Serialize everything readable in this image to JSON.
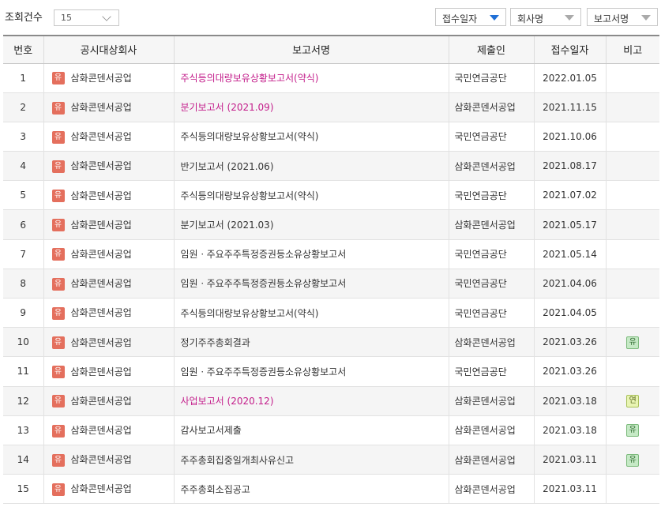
{
  "toolbar": {
    "count_label": "조회건수",
    "count_value": "15",
    "sort_receipt": "접수일자",
    "sort_company": "회사명",
    "sort_report": "보고서명"
  },
  "table": {
    "headers": [
      "번호",
      "공시대상회사",
      "보고서명",
      "제출인",
      "접수일자",
      "비고"
    ],
    "rows": [
      {
        "no": "1",
        "market": "유",
        "company": "삼화콘덴서공업",
        "report": "주식등의대량보유상황보고서(약식)",
        "report_highlight": true,
        "submitter": "국민연금공단",
        "date": "2022.01.05",
        "note": ""
      },
      {
        "no": "2",
        "market": "유",
        "company": "삼화콘덴서공업",
        "report": "분기보고서 (2021.09)",
        "report_highlight": true,
        "submitter": "삼화콘덴서공업",
        "date": "2021.11.15",
        "note": ""
      },
      {
        "no": "3",
        "market": "유",
        "company": "삼화콘덴서공업",
        "report": "주식등의대량보유상황보고서(약식)",
        "report_highlight": false,
        "submitter": "국민연금공단",
        "date": "2021.10.06",
        "note": ""
      },
      {
        "no": "4",
        "market": "유",
        "company": "삼화콘덴서공업",
        "report": "반기보고서 (2021.06)",
        "report_highlight": false,
        "submitter": "삼화콘덴서공업",
        "date": "2021.08.17",
        "note": ""
      },
      {
        "no": "5",
        "market": "유",
        "company": "삼화콘덴서공업",
        "report": "주식등의대량보유상황보고서(약식)",
        "report_highlight": false,
        "submitter": "국민연금공단",
        "date": "2021.07.02",
        "note": ""
      },
      {
        "no": "6",
        "market": "유",
        "company": "삼화콘덴서공업",
        "report": "분기보고서 (2021.03)",
        "report_highlight": false,
        "submitter": "삼화콘덴서공업",
        "date": "2021.05.17",
        "note": ""
      },
      {
        "no": "7",
        "market": "유",
        "company": "삼화콘덴서공업",
        "report": "임원ㆍ주요주주특정증권등소유상황보고서",
        "report_highlight": false,
        "submitter": "국민연금공단",
        "date": "2021.05.14",
        "note": ""
      },
      {
        "no": "8",
        "market": "유",
        "company": "삼화콘덴서공업",
        "report": "임원ㆍ주요주주특정증권등소유상황보고서",
        "report_highlight": false,
        "submitter": "국민연금공단",
        "date": "2021.04.06",
        "note": ""
      },
      {
        "no": "9",
        "market": "유",
        "company": "삼화콘덴서공업",
        "report": "주식등의대량보유상황보고서(약식)",
        "report_highlight": false,
        "submitter": "국민연금공단",
        "date": "2021.04.05",
        "note": ""
      },
      {
        "no": "10",
        "market": "유",
        "company": "삼화콘덴서공업",
        "report": "정기주주총회결과",
        "report_highlight": false,
        "submitter": "삼화콘덴서공업",
        "date": "2021.03.26",
        "note": "유",
        "note_color": "green"
      },
      {
        "no": "11",
        "market": "유",
        "company": "삼화콘덴서공업",
        "report": "임원ㆍ주요주주특정증권등소유상황보고서",
        "report_highlight": false,
        "submitter": "국민연금공단",
        "date": "2021.03.26",
        "note": ""
      },
      {
        "no": "12",
        "market": "유",
        "company": "삼화콘덴서공업",
        "report": "사업보고서 (2020.12)",
        "report_highlight": true,
        "submitter": "삼화콘덴서공업",
        "date": "2021.03.18",
        "note": "연",
        "note_color": "lime"
      },
      {
        "no": "13",
        "market": "유",
        "company": "삼화콘덴서공업",
        "report": "감사보고서제출",
        "report_highlight": false,
        "submitter": "삼화콘덴서공업",
        "date": "2021.03.18",
        "note": "유",
        "note_color": "green"
      },
      {
        "no": "14",
        "market": "유",
        "company": "삼화콘덴서공업",
        "report": "주주총회집중일개최사유신고",
        "report_highlight": false,
        "submitter": "삼화콘덴서공업",
        "date": "2021.03.11",
        "note": "유",
        "note_color": "green"
      },
      {
        "no": "15",
        "market": "유",
        "company": "삼화콘덴서공업",
        "report": "주주총회소집공고",
        "report_highlight": false,
        "submitter": "삼화콘덴서공업",
        "date": "2021.03.11",
        "note": ""
      }
    ]
  },
  "colors": {
    "market_badge": "#e46f5d",
    "report_highlight": "#c31c8a",
    "sort_active_arrow": "#1f6fd6"
  }
}
